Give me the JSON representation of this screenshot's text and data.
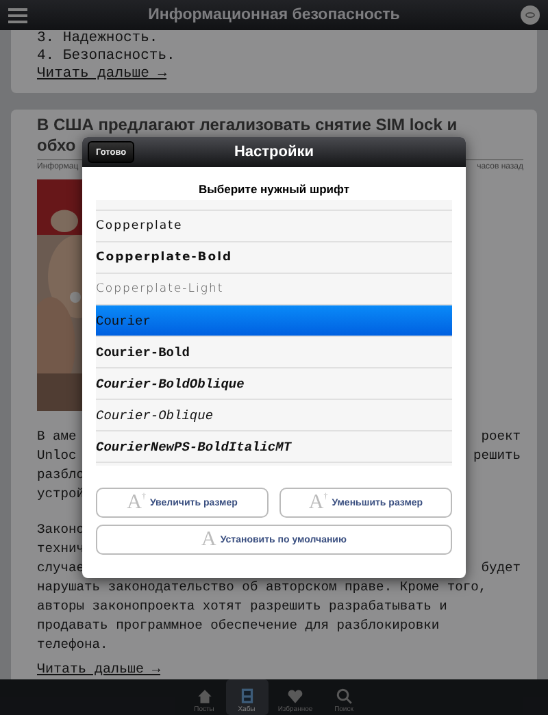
{
  "header": {
    "title": "Информационная безопасность"
  },
  "feed": {
    "first_card": {
      "list": [
        "3. Надежность.",
        "4. Безопасность."
      ],
      "link": "Читать дальше →"
    },
    "second_card": {
      "title_lines": [
        "В США предлагают легализовать снятие SIM lock и",
        "обхо"
      ],
      "meta_left": "Информац",
      "meta_right": "часов назад",
      "paragraphs": [
        [
          {
            "left": "В аме",
            "right": "роект"
          },
          {
            "left": "Unloc",
            "right": "решить"
          },
          {
            "left": "разбло"
          },
          {
            "left": "устрой"
          }
        ],
        [
          {
            "left": "Законо"
          },
          {
            "left": "технич"
          },
          {
            "left": "случае",
            "right": "будет"
          },
          {
            "left": "нарушать законодательство об авторском праве. Кроме того,"
          },
          {
            "left": "авторы законопроекта хотят разрешить разрабатывать и"
          },
          {
            "left": "продавать программное обеспечение для разблокировки"
          },
          {
            "left": "телефона."
          }
        ]
      ],
      "link": "Читать дальше →"
    }
  },
  "popover": {
    "title": "Настройки",
    "done_button": "Готово",
    "prompt": "Выберите нужный шрифт",
    "fonts": [
      {
        "name": "Copperplate",
        "kind": "engraved",
        "bold": false,
        "italic": false,
        "selected": false
      },
      {
        "name": "Copperplate-Bold",
        "kind": "engraved",
        "bold": true,
        "italic": false,
        "selected": false
      },
      {
        "name": "Copperplate-Light",
        "kind": "engraved",
        "bold": false,
        "italic": false,
        "selected": false
      },
      {
        "name": "Courier",
        "kind": "mono",
        "bold": false,
        "italic": false,
        "selected": true
      },
      {
        "name": "Courier-Bold",
        "kind": "mono",
        "bold": true,
        "italic": false,
        "selected": false
      },
      {
        "name": "Courier-BoldOblique",
        "kind": "mono",
        "bold": true,
        "italic": true,
        "selected": false
      },
      {
        "name": "Courier-Oblique",
        "kind": "mono",
        "bold": false,
        "italic": true,
        "selected": false
      },
      {
        "name": "CourierNewPS-BoldItalicMT",
        "kind": "mono",
        "bold": true,
        "italic": true,
        "selected": false
      }
    ],
    "buttons": [
      {
        "label": "Увеличить размер",
        "glyph": "A",
        "mark": "†"
      },
      {
        "label": "Уменьшить размер",
        "glyph": "A",
        "mark": "†"
      },
      {
        "label": "Установить по умолчанию",
        "glyph": "A"
      }
    ]
  },
  "tabs": [
    {
      "label": "Посты",
      "kind": "home",
      "selected": false
    },
    {
      "label": "Хабы",
      "kind": "panels",
      "selected": true
    },
    {
      "label": "Избранное",
      "kind": "heart",
      "selected": false
    },
    {
      "label": "Поиск",
      "kind": "search",
      "selected": false
    }
  ]
}
